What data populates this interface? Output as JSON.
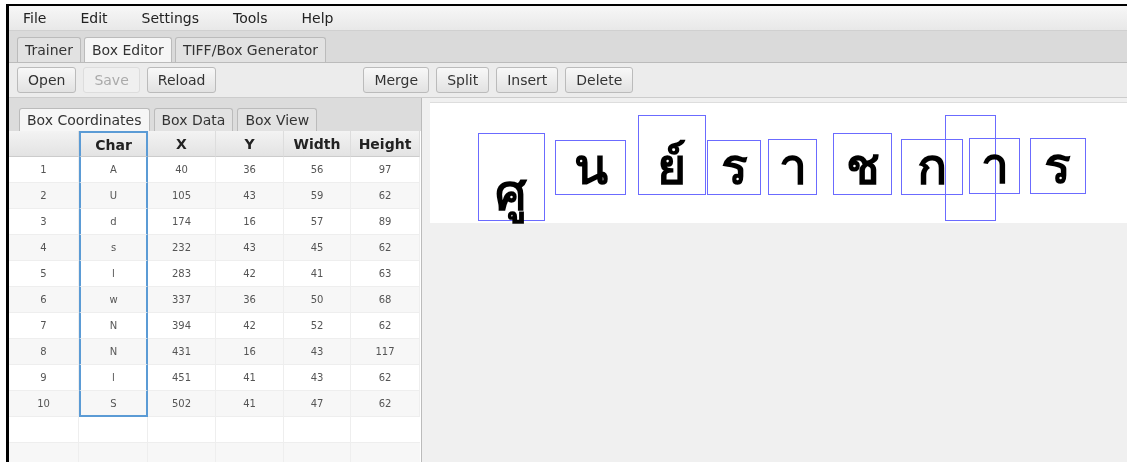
{
  "menu": [
    "File",
    "Edit",
    "Settings",
    "Tools",
    "Help"
  ],
  "tabs": [
    {
      "label": "Trainer",
      "selected": false
    },
    {
      "label": "Box Editor",
      "selected": true
    },
    {
      "label": "TIFF/Box Generator",
      "selected": false
    }
  ],
  "toolbar_left": [
    {
      "label": "Open",
      "disabled": false
    },
    {
      "label": "Save",
      "disabled": true
    },
    {
      "label": "Reload",
      "disabled": false
    }
  ],
  "toolbar_right": [
    {
      "label": "Merge",
      "disabled": false
    },
    {
      "label": "Split",
      "disabled": false
    },
    {
      "label": "Insert",
      "disabled": false
    },
    {
      "label": "Delete",
      "disabled": false
    }
  ],
  "panel_tabs": [
    {
      "label": "Box Coordinates",
      "selected": true
    },
    {
      "label": "Box Data",
      "selected": false
    },
    {
      "label": "Box View",
      "selected": false
    }
  ],
  "table": {
    "columns": [
      {
        "selected": false
      },
      {
        "label": "Char",
        "selected": true
      },
      {
        "label": "X",
        "selected": false
      },
      {
        "label": "Y",
        "selected": false
      },
      {
        "label": "Width",
        "selected": false
      },
      {
        "label": "Height",
        "selected": false
      }
    ],
    "rows": [
      [
        "1",
        "A",
        "40",
        "36",
        "56",
        "97"
      ],
      [
        "2",
        "U",
        "105",
        "43",
        "59",
        "62"
      ],
      [
        "3",
        "d",
        "174",
        "16",
        "57",
        "89"
      ],
      [
        "4",
        "s",
        "232",
        "43",
        "45",
        "62"
      ],
      [
        "5",
        "l",
        "283",
        "42",
        "41",
        "63"
      ],
      [
        "6",
        "w",
        "337",
        "36",
        "50",
        "68"
      ],
      [
        "7",
        "N",
        "394",
        "42",
        "52",
        "62"
      ],
      [
        "8",
        "N",
        "431",
        "16",
        "43",
        "117"
      ],
      [
        "9",
        "l",
        "451",
        "41",
        "43",
        "62"
      ],
      [
        "10",
        "S",
        "502",
        "41",
        "47",
        "62"
      ]
    ]
  },
  "image_boxes": [
    {
      "kind": "glyph",
      "glyph": "ศู"
    },
    {
      "kind": "glyph",
      "glyph": "น"
    },
    {
      "kind": "glyph",
      "glyph": "ย์"
    },
    {
      "kind": "glyph",
      "glyph": "ร"
    },
    {
      "kind": "glyph",
      "glyph": "า"
    },
    {
      "kind": "glyph",
      "glyph": "ช"
    },
    {
      "kind": "glyph",
      "glyph": "ก"
    },
    {
      "kind": "empty"
    },
    {
      "kind": "glyph",
      "glyph": "า"
    },
    {
      "kind": "glyph",
      "glyph": "ร"
    }
  ]
}
